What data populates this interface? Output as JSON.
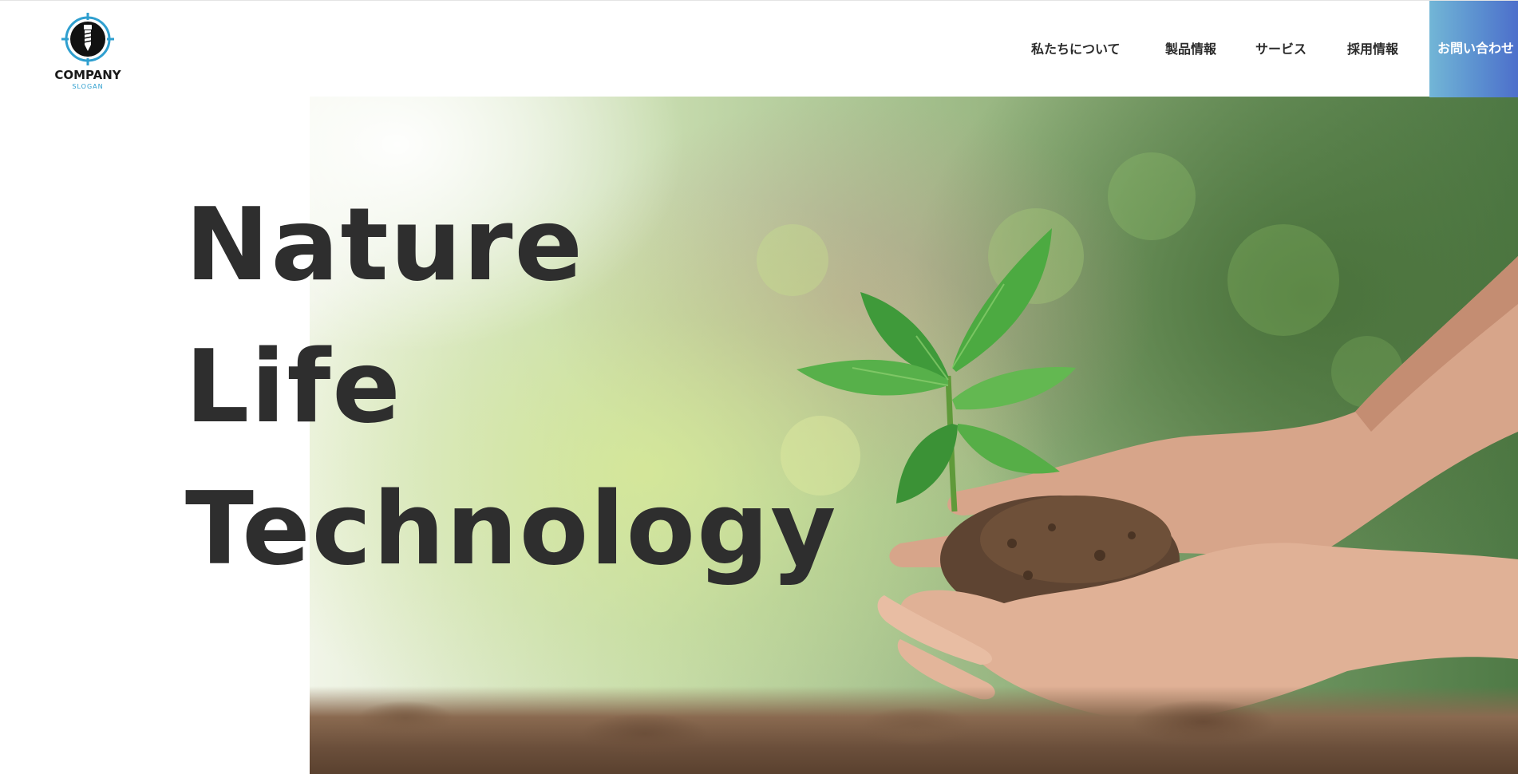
{
  "header": {
    "logo": {
      "name": "COMPANY",
      "slogan": "SLOGAN",
      "icon": "screw-logo-icon"
    },
    "nav": [
      {
        "label": "私たちについて"
      },
      {
        "label": "製品情報"
      },
      {
        "label": "サービス"
      },
      {
        "label": "採用情報"
      }
    ],
    "contact_label": "お問い合わせ"
  },
  "hero": {
    "lines": [
      "Nature",
      "Life",
      "Technology"
    ],
    "image": "seedling-in-cupped-hands-photo"
  },
  "colors": {
    "text": "#2e2e2e",
    "contact_gradient_start": "#72b6d6",
    "contact_gradient_end": "#4d6fcb",
    "logo_accent": "#2f9fcf"
  }
}
